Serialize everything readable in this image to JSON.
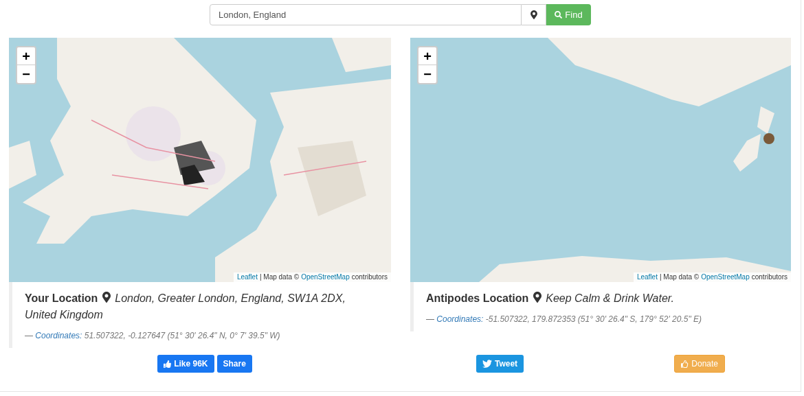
{
  "search": {
    "value": "London, England",
    "find_label": "Find"
  },
  "panels": [
    {
      "zoom_in": "+",
      "zoom_out": "−",
      "attribution": {
        "leaflet": "Leaflet",
        "map_data": "| Map data ©",
        "osm": "OpenStreetMap",
        "contributors": "contributors"
      },
      "title": "Your Location",
      "place": "London, Greater London, England, SW1A 2DX, United Kingdom",
      "coordinates_label": "— ",
      "coordinates_link": "Coordinates:",
      "coordinates": "51.507322, -0.127647 (51° 30' 26.4\" N, 0° 7' 39.5\" W)"
    },
    {
      "zoom_in": "+",
      "zoom_out": "−",
      "attribution": {
        "leaflet": "Leaflet",
        "map_data": "| Map data ©",
        "osm": "OpenStreetMap",
        "contributors": "contributors"
      },
      "title": "Antipodes Location",
      "place": "Keep Calm & Drink Water.",
      "coordinates_label": "— ",
      "coordinates_link": "Coordinates:",
      "coordinates": "-51.507322, 179.872353 (51° 30' 26.4\" S, 179° 52' 20.5\" E)"
    }
  ],
  "buttons": [
    {
      "kind": "like",
      "label": "Like 96K"
    },
    {
      "kind": "share",
      "label": "Share"
    },
    {
      "kind": "tweet",
      "label": "Tweet"
    },
    {
      "kind": "donate",
      "label": "Donate"
    }
  ]
}
